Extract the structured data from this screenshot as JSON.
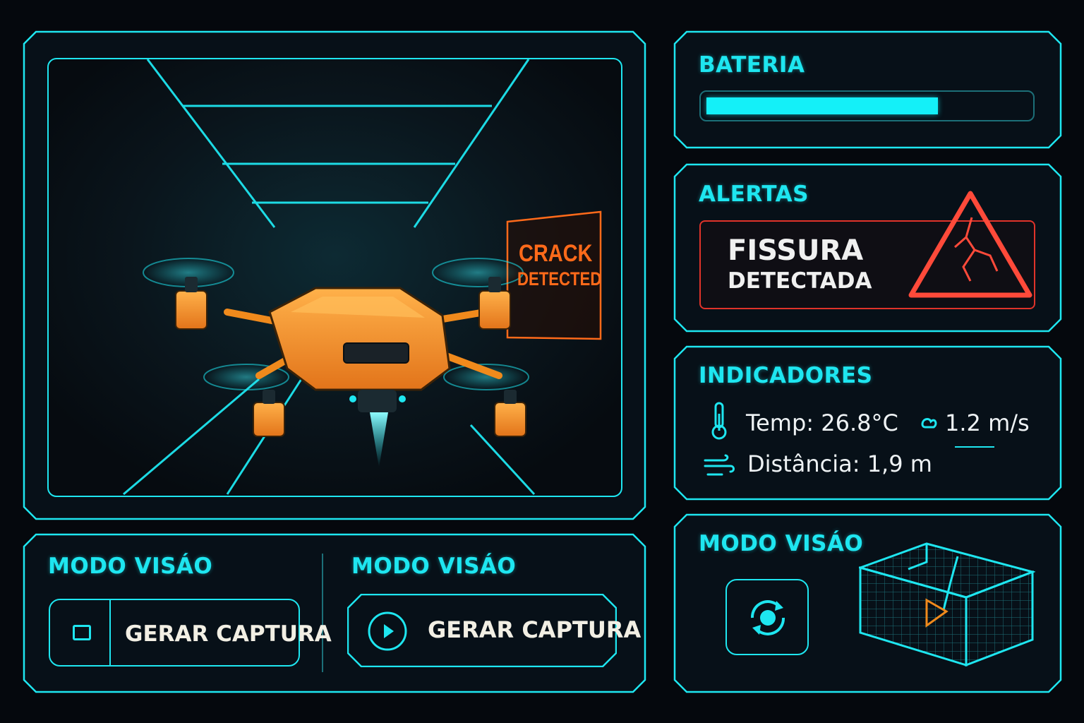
{
  "camera": {
    "overlay_line1": "CRACK",
    "overlay_line2": "DETECTED"
  },
  "battery": {
    "title": "BATERIA",
    "level": 0.72
  },
  "alerts": {
    "title": "ALERTAS",
    "line1": "FISSURA",
    "line2": "DETECTADA",
    "icon": "warning-triangle-crack-icon"
  },
  "indicators": {
    "title": "INDICADORES",
    "temp": "Temp: 26.8°C",
    "speed": "1.2 m/s",
    "distance": "Distância: 1,9 m"
  },
  "vision_left": {
    "title": "MODO VISÁO",
    "button_label": "GERAR CAPTURA"
  },
  "vision_middle": {
    "title": "MODO VISÁO",
    "button_label": "GERAR CAPTURA"
  },
  "vision_right": {
    "title": "MODO VISÁO"
  },
  "colors": {
    "accent": "#1ee6f0",
    "alert": "#ff3b2f",
    "drone": "#f08a1c",
    "background": "#05080d"
  }
}
